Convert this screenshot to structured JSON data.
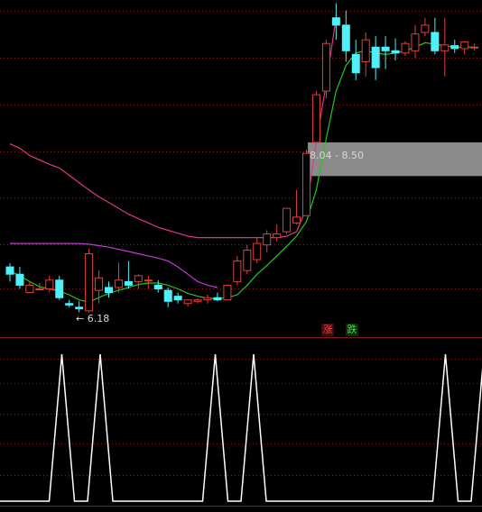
{
  "colors": {
    "background": "#000000",
    "grid": "#7a1a1a",
    "up_candle": "#e0403a",
    "down_candle": "#4ff0f7",
    "ma_short": "#1ec81e",
    "ma_mid": "#e0348a",
    "ma_long": "#c53ad6",
    "band_fill": "#8a8a8a",
    "signal_line": "#ffffff",
    "up_text": "#ff4040",
    "down_text": "#38e838"
  },
  "labels": {
    "low_price": "6.18",
    "zone_range": "8.04 - 8.50",
    "up_button": "涨",
    "down_button": "跌"
  },
  "icons": {
    "low_marker": "left-arrow-icon"
  },
  "chart_data": {
    "type": "candlestick",
    "ohlc_order": [
      "open",
      "high",
      "low",
      "close"
    ],
    "candles": [
      [
        6.8,
        6.85,
        6.6,
        6.7
      ],
      [
        6.7,
        6.8,
        6.5,
        6.55
      ],
      [
        6.45,
        6.6,
        6.45,
        6.55
      ],
      [
        6.5,
        6.58,
        6.48,
        6.5
      ],
      [
        6.5,
        6.68,
        6.45,
        6.62
      ],
      [
        6.62,
        6.68,
        6.35,
        6.38
      ],
      [
        6.3,
        6.35,
        6.25,
        6.28
      ],
      [
        6.25,
        6.33,
        6.18,
        6.23
      ],
      [
        6.2,
        7.05,
        6.18,
        6.98
      ],
      [
        6.48,
        6.75,
        6.3,
        6.65
      ],
      [
        6.52,
        6.6,
        6.38,
        6.45
      ],
      [
        6.52,
        6.86,
        6.45,
        6.62
      ],
      [
        6.6,
        6.88,
        6.5,
        6.55
      ],
      [
        6.6,
        6.7,
        6.5,
        6.68
      ],
      [
        6.61,
        6.68,
        6.5,
        6.62
      ],
      [
        6.55,
        6.62,
        6.45,
        6.5
      ],
      [
        6.48,
        6.52,
        6.25,
        6.33
      ],
      [
        6.4,
        6.45,
        6.3,
        6.35
      ],
      [
        6.3,
        6.35,
        6.26,
        6.35
      ],
      [
        6.33,
        6.37,
        6.3,
        6.35
      ],
      [
        6.35,
        6.42,
        6.3,
        6.38
      ],
      [
        6.38,
        6.45,
        6.33,
        6.35
      ],
      [
        6.35,
        6.55,
        6.35,
        6.55
      ],
      [
        6.6,
        6.95,
        6.55,
        6.88
      ],
      [
        6.75,
        7.1,
        6.7,
        7.03
      ],
      [
        6.9,
        7.2,
        6.85,
        7.12
      ],
      [
        7.1,
        7.3,
        7.0,
        7.25
      ],
      [
        7.2,
        7.38,
        7.15,
        7.25
      ],
      [
        7.28,
        7.6,
        7.25,
        7.6
      ],
      [
        7.4,
        7.85,
        7.38,
        7.48
      ],
      [
        7.5,
        8.4,
        7.5,
        8.35
      ],
      [
        8.5,
        9.2,
        8.5,
        9.15
      ],
      [
        9.2,
        9.9,
        9.1,
        9.85
      ],
      [
        10.2,
        10.4,
        9.9,
        10.1
      ],
      [
        10.1,
        10.3,
        9.6,
        9.75
      ],
      [
        9.7,
        9.9,
        9.35,
        9.45
      ],
      [
        9.6,
        10.0,
        9.4,
        9.9
      ],
      [
        9.8,
        9.95,
        9.35,
        9.52
      ],
      [
        9.8,
        9.95,
        9.5,
        9.75
      ],
      [
        9.75,
        9.92,
        9.62,
        9.72
      ],
      [
        9.72,
        9.88,
        9.68,
        9.85
      ],
      [
        9.75,
        10.1,
        9.65,
        9.98
      ],
      [
        10.0,
        10.2,
        9.95,
        10.1
      ],
      [
        10.0,
        10.2,
        9.7,
        9.75
      ],
      [
        9.75,
        10.2,
        9.4,
        9.83
      ],
      [
        9.82,
        9.9,
        9.72,
        9.78
      ],
      [
        9.78,
        9.88,
        9.7,
        9.87
      ],
      [
        9.8,
        9.85,
        9.75,
        9.8
      ]
    ],
    "ma_short": [
      6.75,
      6.68,
      6.6,
      6.53,
      6.5,
      6.47,
      6.42,
      6.35,
      6.32,
      6.38,
      6.44,
      6.48,
      6.52,
      6.56,
      6.58,
      6.58,
      6.55,
      6.5,
      6.44,
      6.4,
      6.37,
      6.37,
      6.38,
      6.42,
      6.55,
      6.7,
      6.82,
      6.95,
      7.08,
      7.22,
      7.42,
      7.85,
      8.55,
      9.2,
      9.55,
      9.72,
      9.75,
      9.72,
      9.7,
      9.72,
      9.75,
      9.8,
      9.86,
      9.84,
      9.82,
      9.8,
      9.8,
      9.8
    ],
    "ma_mid": [
      8.48,
      8.42,
      8.32,
      8.26,
      8.2,
      8.15,
      8.05,
      7.95,
      7.85,
      7.76,
      7.68,
      7.6,
      7.52,
      7.46,
      7.4,
      7.34,
      7.3,
      7.26,
      7.22,
      7.2,
      7.2,
      7.2,
      7.2,
      7.2,
      7.2,
      7.2,
      7.2,
      7.2,
      7.22,
      7.28,
      7.6,
      8.5,
      9.3,
      10.2
    ],
    "ma_long": [
      7.12,
      7.12,
      7.12,
      7.12,
      7.12,
      7.12,
      7.12,
      7.12,
      7.11,
      7.09,
      7.07,
      7.04,
      7.01,
      6.98,
      6.95,
      6.92,
      6.88,
      6.8,
      6.7,
      6.6,
      6.55,
      6.52
    ],
    "zone": {
      "low": 8.04,
      "high": 8.5
    },
    "price_low": 6.18,
    "signal_peaks": [
      1,
      2,
      5,
      6,
      11,
      12
    ],
    "signal_count": 13
  }
}
